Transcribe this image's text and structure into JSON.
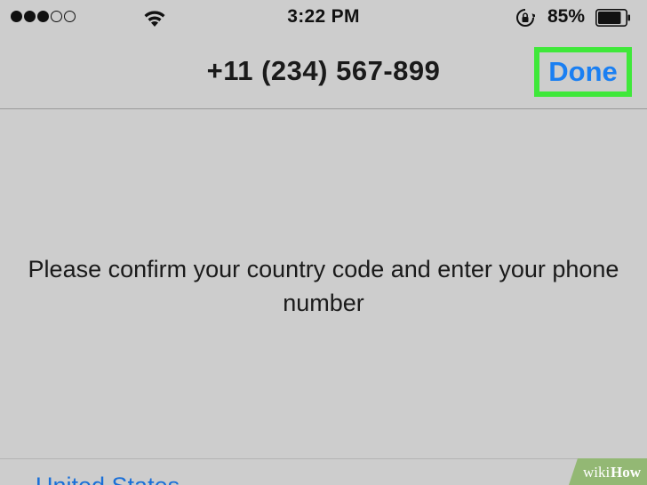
{
  "status_bar": {
    "time": "3:22 PM",
    "battery_percent": "85%",
    "signal_bars_filled": 3,
    "signal_bars_total": 5,
    "battery_level": 0.85
  },
  "nav": {
    "title": "+11 (234) 567-899",
    "done_label": "Done",
    "highlight_color": "#3fe83a",
    "accent_color": "#1a7ff2"
  },
  "main": {
    "message": "Please confirm your country code and enter your phone number"
  },
  "country": {
    "label": "United States"
  },
  "watermark": {
    "text": "wikiHow"
  }
}
